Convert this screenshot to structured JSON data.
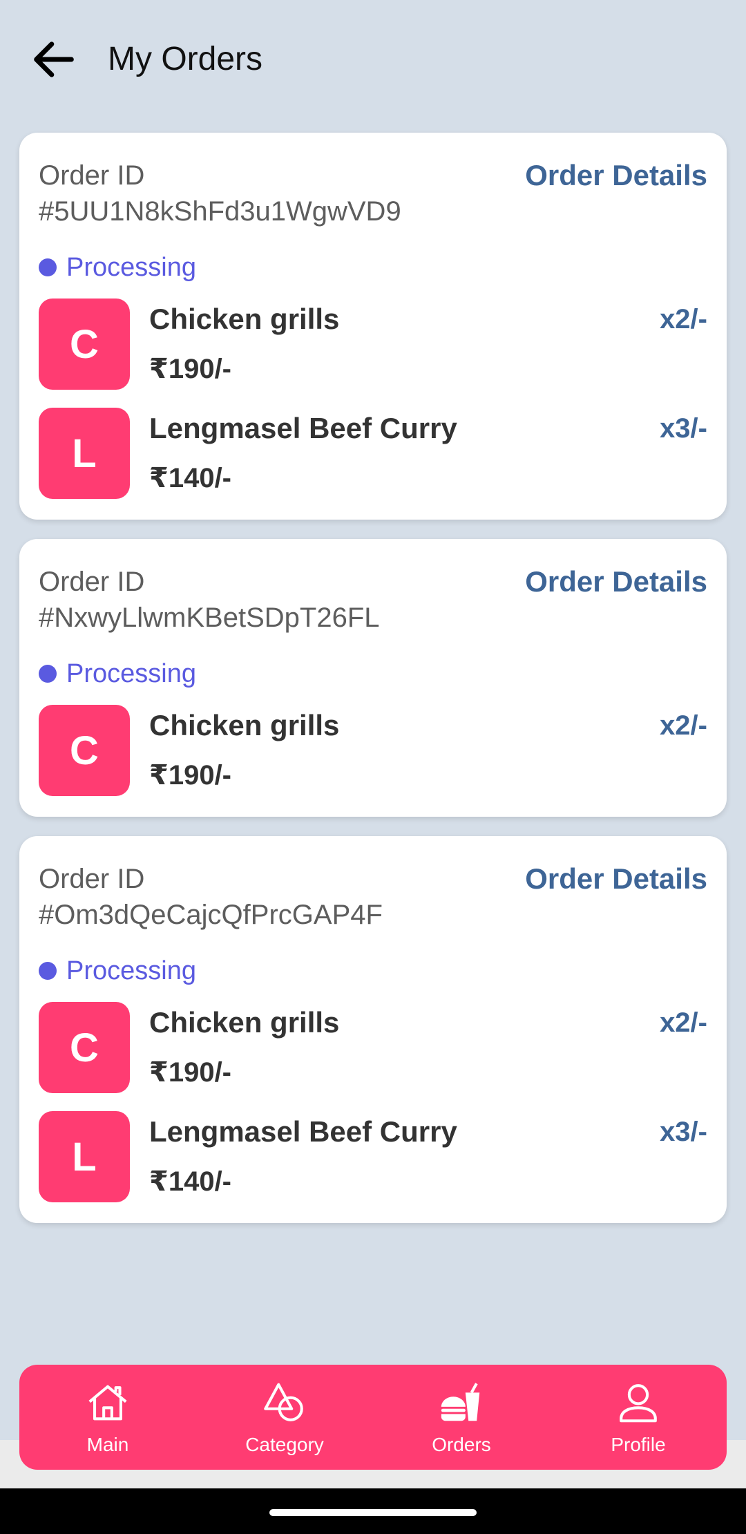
{
  "header": {
    "title": "My Orders",
    "back_icon": "arrow-left-icon"
  },
  "orders": [
    {
      "label": "Order ID",
      "id": "#5UU1N8kShFd3u1WgwVD9",
      "details_link": "Order Details",
      "status": "Processing",
      "items": [
        {
          "initial": "C",
          "name": "Chicken grills",
          "price": "₹190/-",
          "qty": "x2/-"
        },
        {
          "initial": "L",
          "name": "Lengmasel Beef Curry",
          "price": "₹140/-",
          "qty": "x3/-"
        }
      ]
    },
    {
      "label": "Order ID",
      "id": "#NxwyLlwmKBetSDpT26FL",
      "details_link": "Order Details",
      "status": "Processing",
      "items": [
        {
          "initial": "C",
          "name": "Chicken grills",
          "price": "₹190/-",
          "qty": "x2/-"
        }
      ]
    },
    {
      "label": "Order ID",
      "id": "#Om3dQeCajcQfPrcGAP4F",
      "details_link": "Order Details",
      "status": "Processing",
      "items": [
        {
          "initial": "C",
          "name": "Chicken grills",
          "price": "₹190/-",
          "qty": "x2/-"
        },
        {
          "initial": "L",
          "name": "Lengmasel Beef Curry",
          "price": "₹140/-",
          "qty": "x3/-"
        }
      ]
    }
  ],
  "nav": [
    {
      "label": "Main",
      "icon": "home-icon"
    },
    {
      "label": "Category",
      "icon": "shapes-icon"
    },
    {
      "label": "Orders",
      "icon": "fast-food-icon"
    },
    {
      "label": "Profile",
      "icon": "user-icon"
    }
  ],
  "colors": {
    "background": "#d5dee8",
    "accent": "#ff3c72",
    "link": "#3e6596",
    "status": "#5a5ae0"
  }
}
